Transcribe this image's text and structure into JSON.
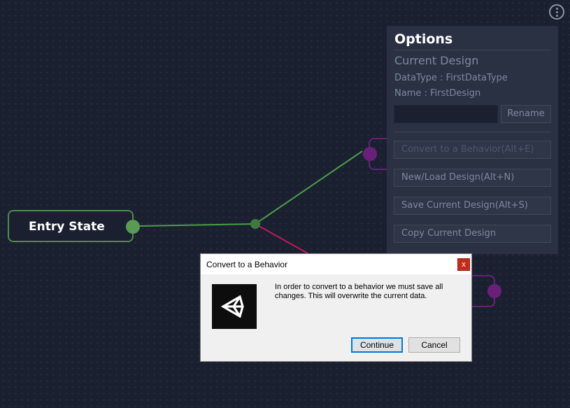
{
  "graph": {
    "entry_node_label": "Entry State",
    "edge_colors": {
      "to_upper": "#4a9e48",
      "to_lower": "#c2185b",
      "from_entry": "#4a9e48"
    }
  },
  "options_panel": {
    "title": "Options",
    "subtitle": "Current Design",
    "datatype_text": "DataType : FirstDataType",
    "name_text": "Name : FirstDesign",
    "rename_input_value": "",
    "rename_label": "Rename",
    "buttons": [
      {
        "label": "Convert to a Behavior(Alt+E)",
        "disabled": true
      },
      {
        "label": "New/Load Design(Alt+N)",
        "disabled": false
      },
      {
        "label": "Save Current Design(Alt+S)",
        "disabled": false
      },
      {
        "label": "Copy Current Design",
        "disabled": false
      }
    ]
  },
  "dialog": {
    "title": "Convert to a Behavior",
    "close_label": "x",
    "message": "In order to convert to a behavior we must save all changes. This will overwrite the current data.",
    "continue_label": "Continue",
    "cancel_label": "Cancel"
  },
  "icons": {
    "menu": "more-vertical-icon",
    "app_logo": "unity-logo-icon"
  },
  "colors": {
    "background": "#1b2030",
    "panel": "#2a3143",
    "node_border": "#4f8a4c",
    "port_purple": "#6b1f7a"
  }
}
